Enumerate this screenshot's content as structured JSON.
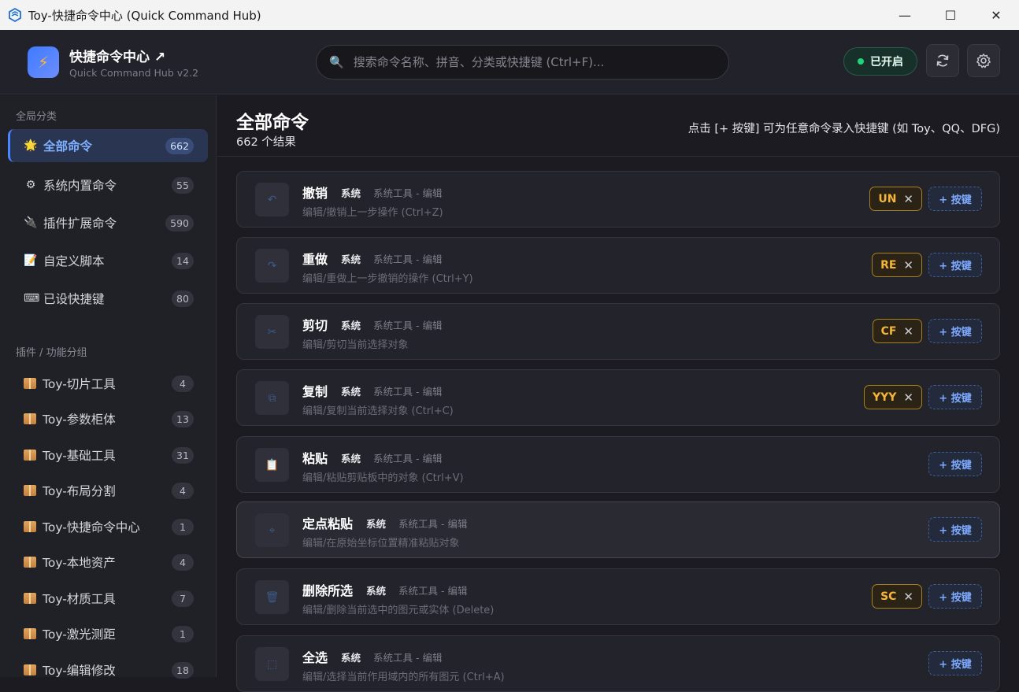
{
  "window": {
    "title": "Toy-快捷命令中心 (Quick Command Hub)",
    "minimize": "—",
    "maximize": "☐",
    "close": "✕"
  },
  "header": {
    "brand_title": "快捷命令中心 ↗",
    "brand_sub": "Quick Command Hub v2.2",
    "search_placeholder": "搜索命令名称、拼音、分类或快捷键 (Ctrl+F)...",
    "status": "已开启",
    "colors": {
      "accent": "#4a86ff",
      "status": "#20d47a",
      "shortcut": "#f5b53a"
    }
  },
  "sidebar": {
    "section1": "全局分类",
    "global": [
      {
        "label": "全部命令",
        "count": "662",
        "icon": "sun-icon",
        "glyph": "🌟"
      },
      {
        "label": "系统内置命令",
        "count": "55",
        "icon": "gear-icon",
        "glyph": "⚙"
      },
      {
        "label": "插件扩展命令",
        "count": "590",
        "icon": "plug-icon",
        "glyph": "🔌"
      },
      {
        "label": "自定义脚本",
        "count": "14",
        "icon": "document-icon",
        "glyph": "📝"
      },
      {
        "label": "已设快捷键",
        "count": "80",
        "icon": "keyboard-icon",
        "glyph": "⌨"
      }
    ],
    "section2": "插件 / 功能分组",
    "groups": [
      {
        "label": "Toy-切片工具",
        "count": "4"
      },
      {
        "label": "Toy-参数柜体",
        "count": "13"
      },
      {
        "label": "Toy-基础工具",
        "count": "31"
      },
      {
        "label": "Toy-布局分割",
        "count": "4"
      },
      {
        "label": "Toy-快捷命令中心",
        "count": "1"
      },
      {
        "label": "Toy-本地资产",
        "count": "4"
      },
      {
        "label": "Toy-材质工具",
        "count": "7"
      },
      {
        "label": "Toy-激光测距",
        "count": "1"
      },
      {
        "label": "Toy-编辑修改",
        "count": "18"
      }
    ]
  },
  "main": {
    "title": "全部命令",
    "count": "662 个结果",
    "hint": "点击 [+ 按键] 可为任意命令录入快捷键 (如 Toy、QQ、DFG)",
    "add_label": "+ 按键",
    "commands": [
      {
        "name": "撤销",
        "tag": "系统",
        "category": "系统工具 - 编辑",
        "desc": "编辑/撤销上一步操作 (Ctrl+Z)",
        "shortcut": "UN"
      },
      {
        "name": "重做",
        "tag": "系统",
        "category": "系统工具 - 编辑",
        "desc": "编辑/重做上一步撤销的操作 (Ctrl+Y)",
        "shortcut": "RE"
      },
      {
        "name": "剪切",
        "tag": "系统",
        "category": "系统工具 - 编辑",
        "desc": "编辑/剪切当前选择对象",
        "shortcut": "CF"
      },
      {
        "name": "复制",
        "tag": "系统",
        "category": "系统工具 - 编辑",
        "desc": "编辑/复制当前选择对象 (Ctrl+C)",
        "shortcut": "YYY"
      },
      {
        "name": "粘贴",
        "tag": "系统",
        "category": "系统工具 - 编辑",
        "desc": "编辑/粘贴剪贴板中的对象 (Ctrl+V)",
        "shortcut": ""
      },
      {
        "name": "定点粘贴",
        "tag": "系统",
        "category": "系统工具 - 编辑",
        "desc": "编辑/在原始坐标位置精准粘贴对象",
        "shortcut": ""
      },
      {
        "name": "删除所选",
        "tag": "系统",
        "category": "系统工具 - 编辑",
        "desc": "编辑/删除当前选中的图元或实体 (Delete)",
        "shortcut": "SC"
      },
      {
        "name": "全选",
        "tag": "系统",
        "category": "系统工具 - 编辑",
        "desc": "编辑/选择当前作用域内的所有图元 (Ctrl+A)",
        "shortcut": ""
      }
    ]
  }
}
